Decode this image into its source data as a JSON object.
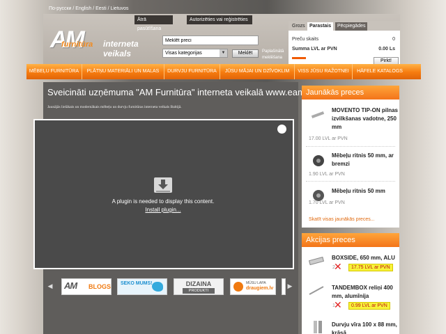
{
  "lang_bar": "По-русски / English / Eesti / Lietuvos",
  "header": {
    "forgot_label": "Ātrā pasūtīšana",
    "auth_label": "Autorizēties vai reģistrēties",
    "logo_am": "AM",
    "logo_furn": "furnitūra",
    "logo_tagline": "interneta veikals"
  },
  "search": {
    "value": "Meklēt preci",
    "category": "Visas kategorijas",
    "button": "Meklēt",
    "advanced": "Paplašinātā meklēšana"
  },
  "cart": {
    "tabs": [
      "Grozs",
      "Parastais",
      "Pēcpiegādes"
    ],
    "count_label": "Preču skaits",
    "count_value": "0",
    "sum_label": "Summa LVL ar PVN",
    "sum_value": "0.00 Ls",
    "buy_label": "Pirkt!"
  },
  "nav": [
    "MĒBEĻU FURNITŪRA",
    "PLĀTŅU MATERIĀLI UN MALAS",
    "DURVJU FURNITŪRA",
    "JŪSU MĀJAI UN DZĪVOKLIM",
    "VISS JŪSU RAŽOTNEI",
    "HĀFELE KATALOGS"
  ],
  "main": {
    "welcome": "Sveicināti uzņēmuma \"AM Furnitūra\" interneta veikalā www.eamf.lv",
    "intro": "Jaunājās lielākais un modernākais mēbeļu un durvju furnitūras interneta veikals Baltijā.",
    "plugin_message": "A plugin is needed to display this content.",
    "plugin_link": "Install plugin..."
  },
  "banners": {
    "blogs": "BLOGS",
    "seko": "SEKO MUMS!",
    "dizaina_1": "DIZAINA",
    "dizaina_2": "PRODUKTI",
    "draugiem_1": "MŪSU LAPA",
    "draugiem_2": "draugiem.lv"
  },
  "new_products": {
    "title": "Jaunākās preces",
    "items": [
      {
        "name": "MOVENTO TIP-ON pilnas izvilkšanas vadotne, 250 mm",
        "price": "17.00 LVL ar PVN"
      },
      {
        "name": "Mēbeļu ritnis 50 mm, ar bremzi",
        "price": "1.90 LVL ar PVN"
      },
      {
        "name": "Mēbeļu ritnis 50 mm",
        "price": "1.70 LVL ar PVN"
      }
    ],
    "see_all": "Skatīt visas jaunākās preces..."
  },
  "sale_products": {
    "title": "Akcijas preces",
    "items": [
      {
        "name": "BOXSIDE, 650 mm, ALU",
        "old": "2.",
        "price": "17.75 LVL ar PVN"
      },
      {
        "name": "TANDEMBOX reliņi 400 mm, alumīnija",
        "old": "1.",
        "price": "0.99 LVL ar PVN"
      },
      {
        "name": "Durvju vīra 100 x 88 mm, krāsā",
        "old": "",
        "price": ""
      }
    ]
  },
  "colors": {
    "accent": "#f67b0f",
    "sale_highlight": "#f7f33a"
  }
}
